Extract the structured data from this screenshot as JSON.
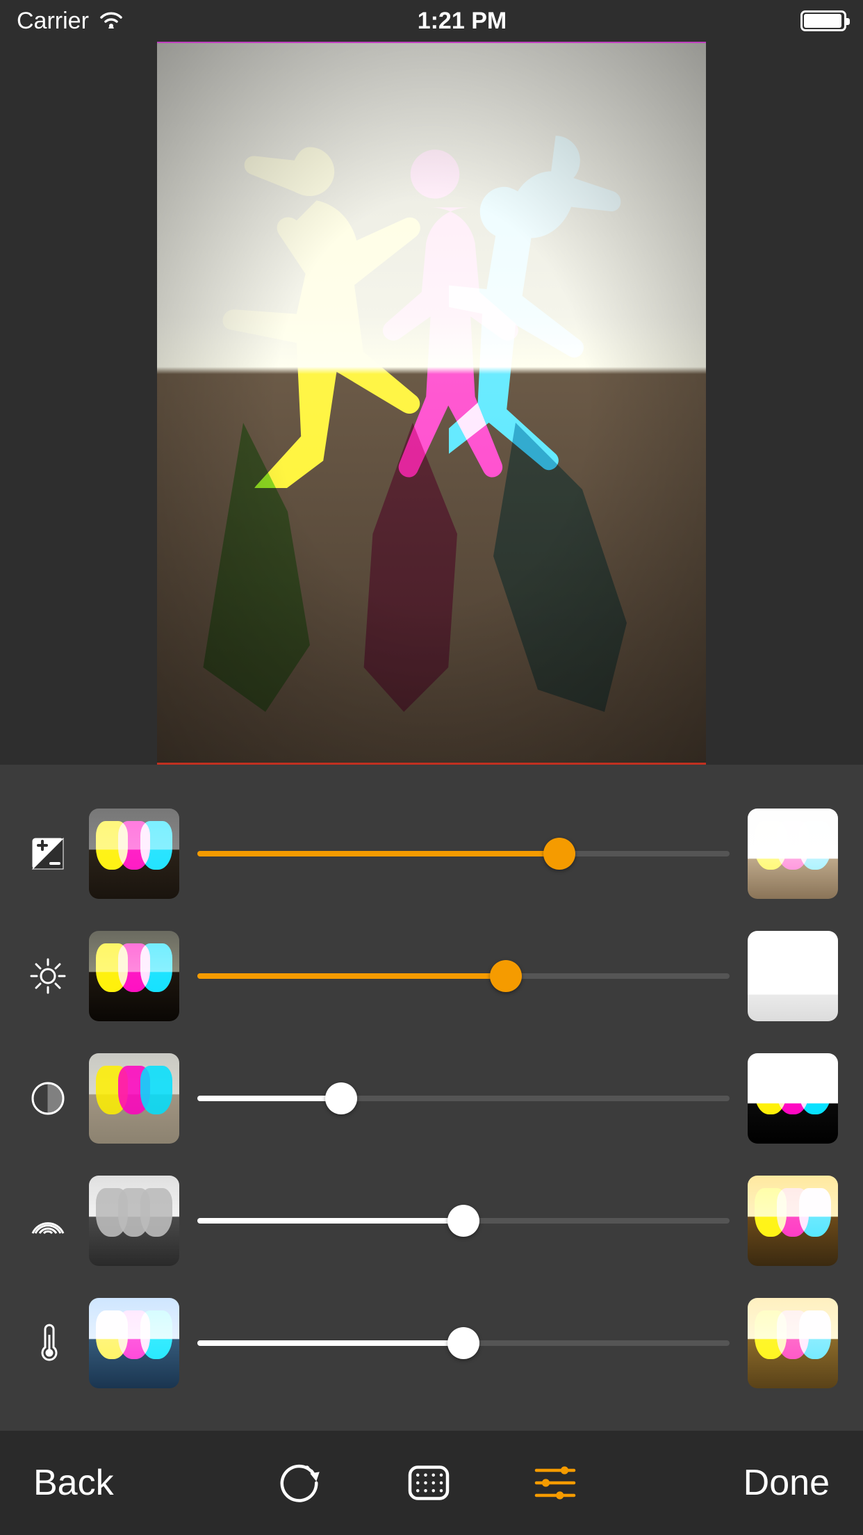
{
  "status_bar": {
    "carrier": "Carrier",
    "time": "1:21 PM"
  },
  "colors": {
    "accent": "#f59b00",
    "knob_white": "#ffffff",
    "knob_accent": "#f59b00",
    "track_idle": "#555555",
    "track_fill_white": "#ffffff",
    "cmy_yellow": "#fff000",
    "cmy_magenta": "#ff00c0",
    "cmy_cyan": "#00e0ff"
  },
  "adjustments": [
    {
      "id": "exposure",
      "icon": "exposure-icon",
      "changed": true,
      "value": 0.68,
      "thumb_low": "tv-dark",
      "thumb_high": "tv-bright"
    },
    {
      "id": "brightness",
      "icon": "brightness-icon",
      "changed": true,
      "value": 0.58,
      "thumb_low": "tv-brdark",
      "thumb_high": "tv-brlite"
    },
    {
      "id": "contrast",
      "icon": "contrast-icon",
      "changed": false,
      "value": 0.27,
      "thumb_low": "tv-ctlow",
      "thumb_high": "tv-cthigh"
    },
    {
      "id": "saturation",
      "icon": "saturation-icon",
      "changed": false,
      "value": 0.5,
      "thumb_low": "tv-bw",
      "thumb_high": "tv-sat"
    },
    {
      "id": "temperature",
      "icon": "temperature-icon",
      "changed": false,
      "value": 0.5,
      "thumb_low": "tv-cool",
      "thumb_high": "tv-warm"
    }
  ],
  "bottom_bar": {
    "back_label": "Back",
    "done_label": "Done",
    "tools": [
      {
        "id": "rotate",
        "icon": "rotate-icon",
        "active": false
      },
      {
        "id": "texture",
        "icon": "texture-icon",
        "active": false
      },
      {
        "id": "sliders",
        "icon": "sliders-icon",
        "active": true
      }
    ]
  }
}
